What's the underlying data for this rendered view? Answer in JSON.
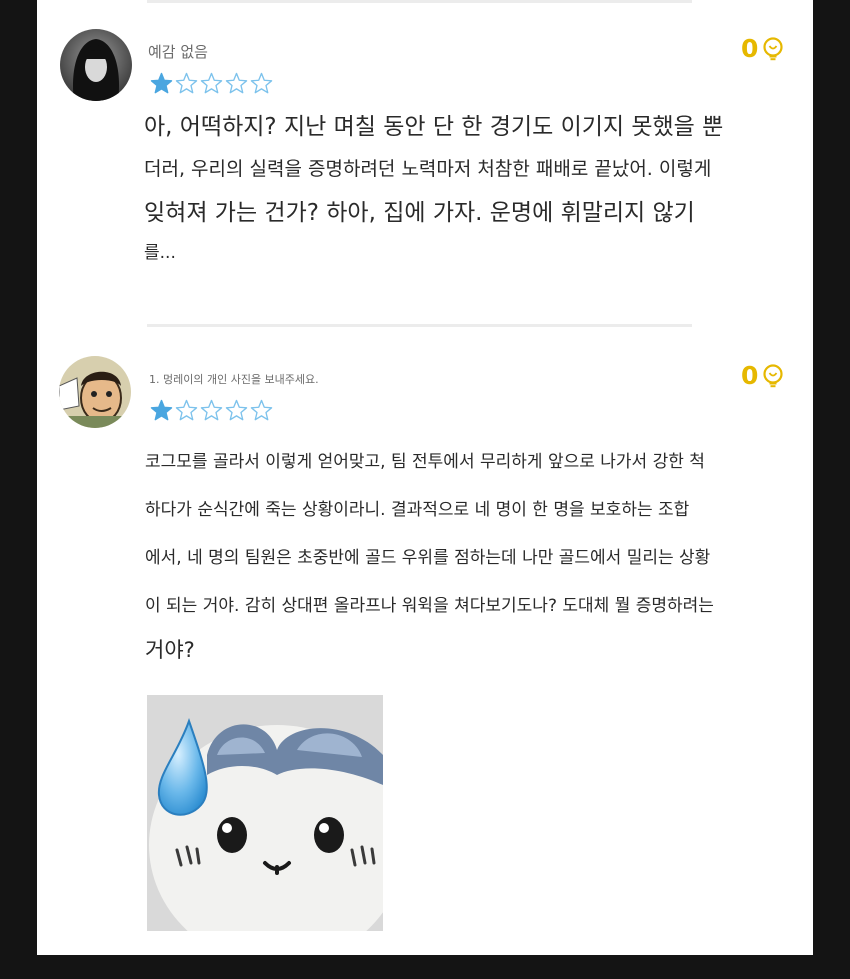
{
  "reviews": [
    {
      "username": "예감 없음",
      "rating": 1,
      "max_rating": 5,
      "likes": "0",
      "icons": {
        "avatar": "avatar-dark-hair",
        "like": "lightbulb-icon",
        "star": "star-icon"
      },
      "lines": [
        "아, 어떡하지? 지난 며칠 동안 단 한 경기도 이기지 못했을 뿐",
        "더러, 우리의 실력을 증명하려던 노력마저 처참한 패배로 끝났어. 이렇게",
        "잊혀져 가는 건가? 하아, 집에 가자. 운명에 휘말리지 않기",
        "를..."
      ]
    },
    {
      "username": "1. 멍레이의 개인 사진을 보내주세요.",
      "rating": 1,
      "max_rating": 5,
      "likes": "0",
      "icons": {
        "avatar": "avatar-cartoon",
        "like": "lightbulb-icon",
        "star": "star-icon",
        "sticker": "sweating-hamster-sticker"
      },
      "lines": [
        "코그모를 골라서 이렇게 얻어맞고, 팀 전투에서 무리하게 앞으로 나가서 강한 척",
        "하다가 순식간에 죽는 상황이라니. 결과적으로 네 명이 한 명을 보호하는 조합",
        "에서, 네 명의 팀원은 초중반에 골드 우위를 점하는데 나만 골드에서 밀리는 상황",
        "이 되는 거야. 감히 상대편 올라프나 워윅을 쳐다보기도나? 도대체 뭘 증명하려는",
        "거야?"
      ]
    }
  ],
  "colors": {
    "star_filled": "#4aa6e0",
    "star_outline": "#7cc2ec",
    "likes": "#e6b800",
    "background": "#141414",
    "card": "#ffffff"
  }
}
